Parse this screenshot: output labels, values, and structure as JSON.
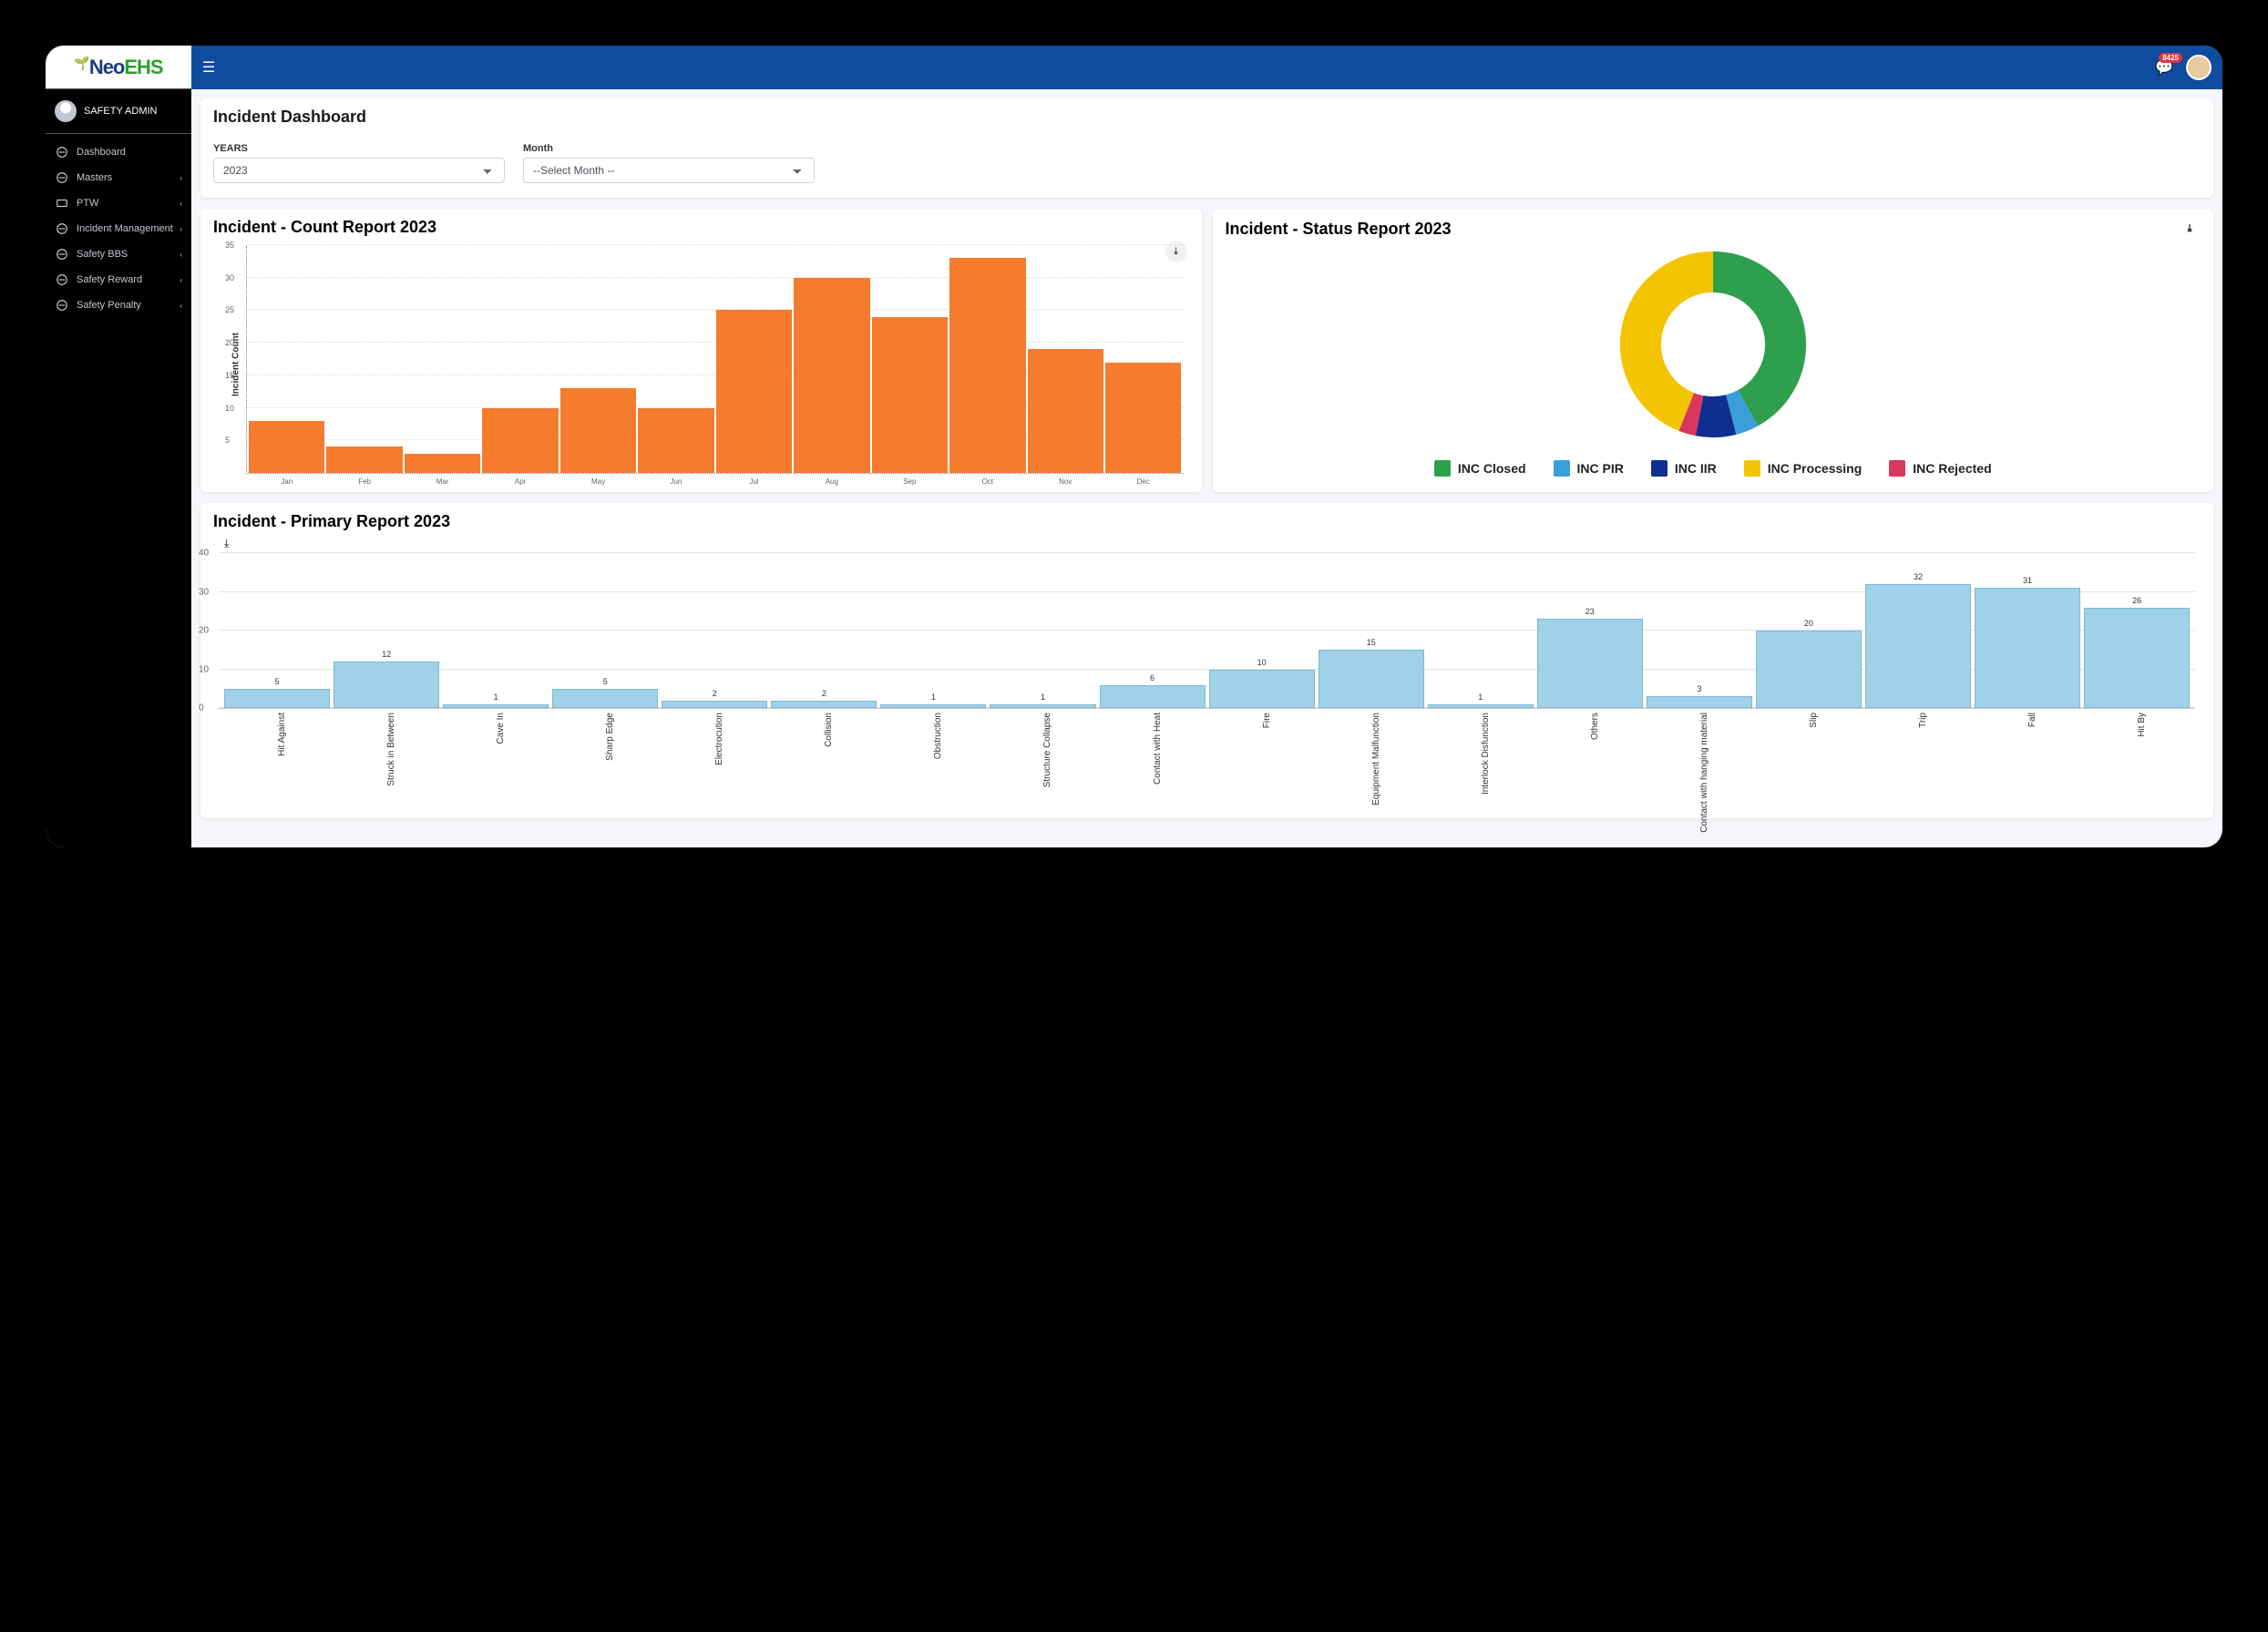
{
  "app": {
    "logo_neo": "Neo",
    "logo_ehs": "EHS",
    "user": "SAFETY ADMIN",
    "notif_count": "8425"
  },
  "sidebar": {
    "items": [
      {
        "label": "Dashboard",
        "chevron": false
      },
      {
        "label": "Masters",
        "chevron": true
      },
      {
        "label": "PTW",
        "chevron": true
      },
      {
        "label": "Incident Management",
        "chevron": true
      },
      {
        "label": "Safety BBS",
        "chevron": true
      },
      {
        "label": "Safety Reward",
        "chevron": true
      },
      {
        "label": "Safety Penalty",
        "chevron": true
      }
    ]
  },
  "page": {
    "title": "Incident Dashboard",
    "filters": {
      "years_label": "YEARS",
      "years_value": "2023",
      "month_label": "Month",
      "month_value": "--Select Month --"
    }
  },
  "charts": {
    "count": {
      "title": "Incident - Count Report 2023",
      "ylabel": "Incident Count"
    },
    "status": {
      "title": "Incident - Status Report 2023"
    },
    "primary": {
      "title": "Incident - Primary Report 2023"
    }
  },
  "chart_data": [
    {
      "id": "count_report",
      "type": "bar",
      "title": "Incident - Count Report 2023",
      "ylabel": "Incident Count",
      "xlabel": "",
      "categories": [
        "Jan",
        "Feb",
        "Mar",
        "Apr",
        "May",
        "Jun",
        "Jul",
        "Aug",
        "Sep",
        "Oct",
        "Nov",
        "Dec"
      ],
      "values": [
        8,
        4,
        3,
        10,
        13,
        10,
        25,
        30,
        24,
        33,
        19,
        17
      ],
      "ylim": [
        0,
        35
      ],
      "yticks": [
        5,
        10,
        15,
        20,
        25,
        30,
        35
      ],
      "color": "#f47c2c"
    },
    {
      "id": "status_report",
      "type": "pie",
      "title": "Incident - Status Report 2023",
      "series": [
        {
          "name": "INC Closed",
          "value": 42,
          "color": "#2e9f4c"
        },
        {
          "name": "INC PIR",
          "value": 4,
          "color": "#3a9fd8"
        },
        {
          "name": "INC IIR",
          "value": 7,
          "color": "#0e2f8f"
        },
        {
          "name": "INC Processing",
          "value": 44,
          "color": "#f5c400"
        },
        {
          "name": "INC Rejected",
          "value": 3,
          "color": "#d9375d"
        }
      ]
    },
    {
      "id": "primary_report",
      "type": "bar",
      "title": "Incident - Primary Report 2023",
      "ylabel": "",
      "xlabel": "",
      "categories": [
        "Hit Against",
        "Struck in Between",
        "Cave In",
        "Sharp Edge",
        "Electrocution",
        "Collision",
        "Obstruction",
        "Structure Collapse",
        "Contact with Heat",
        "Fire",
        "Equipment Malfunction",
        "Interlock Disfunction",
        "Others",
        "Contact with hanging material",
        "Slip",
        "Trip",
        "Fall",
        "Hit By"
      ],
      "values": [
        5,
        12,
        1,
        5,
        2,
        2,
        1,
        1,
        6,
        10,
        15,
        1,
        23,
        3,
        20,
        32,
        31,
        26
      ],
      "ylim": [
        0,
        40
      ],
      "yticks": [
        0,
        10,
        20,
        30,
        40
      ],
      "color": "#9fd2e8"
    }
  ]
}
